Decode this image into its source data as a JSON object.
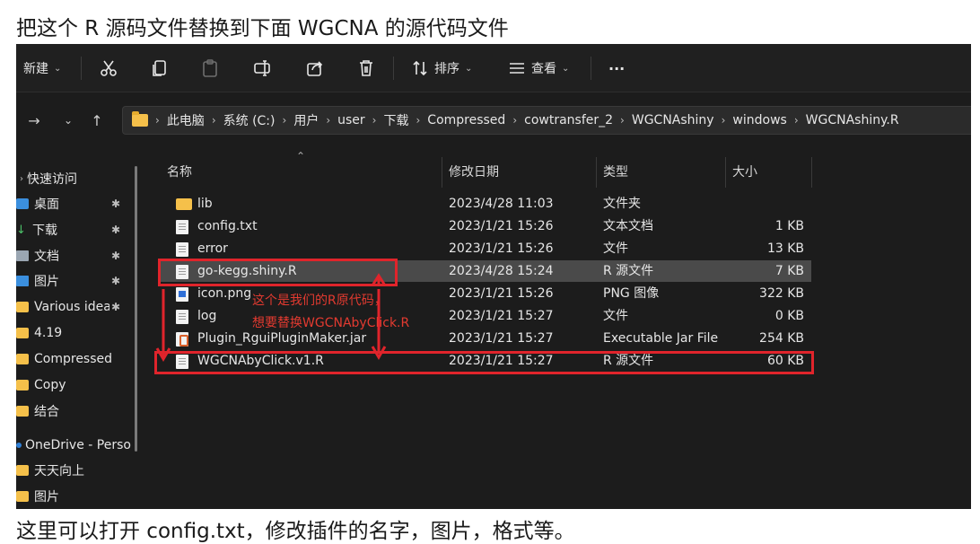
{
  "captions": {
    "top": "把这个 R 源码文件替换到下面 WGCNA 的源代码文件",
    "bottom": "这里可以打开 config.txt，修改插件的名字，图片，格式等。"
  },
  "toolbar": {
    "new_label": "新建",
    "sort_label": "排序",
    "view_label": "查看",
    "more_label": "···"
  },
  "address": {
    "crumbs": [
      "此电脑",
      "系统 (C:)",
      "用户",
      "user",
      "下载",
      "Compressed",
      "cowtransfer_2",
      "WGCNAshiny",
      "windows",
      "WGCNAshiny.R"
    ]
  },
  "nav": {
    "quick_access": "快速访问",
    "items": [
      {
        "label": "桌面",
        "icon": "desktop-icon",
        "pinned": true
      },
      {
        "label": "下载",
        "icon": "download-icon",
        "pinned": true
      },
      {
        "label": "文档",
        "icon": "documents-icon",
        "pinned": true
      },
      {
        "label": "图片",
        "icon": "pictures-icon",
        "pinned": true
      },
      {
        "label": "Various idea",
        "icon": "folder-icon",
        "pinned": true
      },
      {
        "label": "4.19",
        "icon": "folder-icon",
        "pinned": false
      },
      {
        "label": "Compressed",
        "icon": "folder-icon",
        "pinned": false
      },
      {
        "label": "Copy",
        "icon": "folder-icon",
        "pinned": false
      },
      {
        "label": "结合",
        "icon": "folder-icon",
        "pinned": false
      },
      {
        "label": "OneDrive - Perso",
        "icon": "onedrive-icon",
        "pinned": false
      },
      {
        "label": "天天向上",
        "icon": "folder-icon",
        "pinned": false
      },
      {
        "label": "图片",
        "icon": "folder-icon",
        "pinned": false
      }
    ]
  },
  "columns": {
    "name": "名称",
    "date": "修改日期",
    "type": "类型",
    "size": "大小"
  },
  "files": [
    {
      "name": "lib",
      "date": "2023/4/28 11:03",
      "type": "文件夹",
      "size": "",
      "icon": "folder"
    },
    {
      "name": "config.txt",
      "date": "2023/1/21 15:26",
      "type": "文本文档",
      "size": "1 KB",
      "icon": "doc"
    },
    {
      "name": "error",
      "date": "2023/1/21 15:26",
      "type": "文件",
      "size": "13 KB",
      "icon": "doc"
    },
    {
      "name": "go-kegg.shiny.R",
      "date": "2023/4/28 15:24",
      "type": "R 源文件",
      "size": "7 KB",
      "icon": "doc"
    },
    {
      "name": "icon.png",
      "date": "2023/1/21 15:26",
      "type": "PNG 图像",
      "size": "322 KB",
      "icon": "img"
    },
    {
      "name": "log",
      "date": "2023/1/21 15:27",
      "type": "文件",
      "size": "0 KB",
      "icon": "doc"
    },
    {
      "name": "Plugin_RguiPluginMaker.jar",
      "date": "2023/1/21 15:27",
      "type": "Executable Jar File",
      "size": "254 KB",
      "icon": "jar"
    },
    {
      "name": "WGCNAbyClick.v1.R",
      "date": "2023/1/21 15:27",
      "type": "R 源文件",
      "size": "60 KB",
      "icon": "doc"
    }
  ],
  "annotation": {
    "line1": "这个是我们的R原代码，",
    "line2": "想要替换WGCNAbyClick.R"
  },
  "colors": {
    "annotation_red": "#e0242b",
    "folder_yellow": "#f5c04a",
    "selection": "#4a4a4a"
  }
}
